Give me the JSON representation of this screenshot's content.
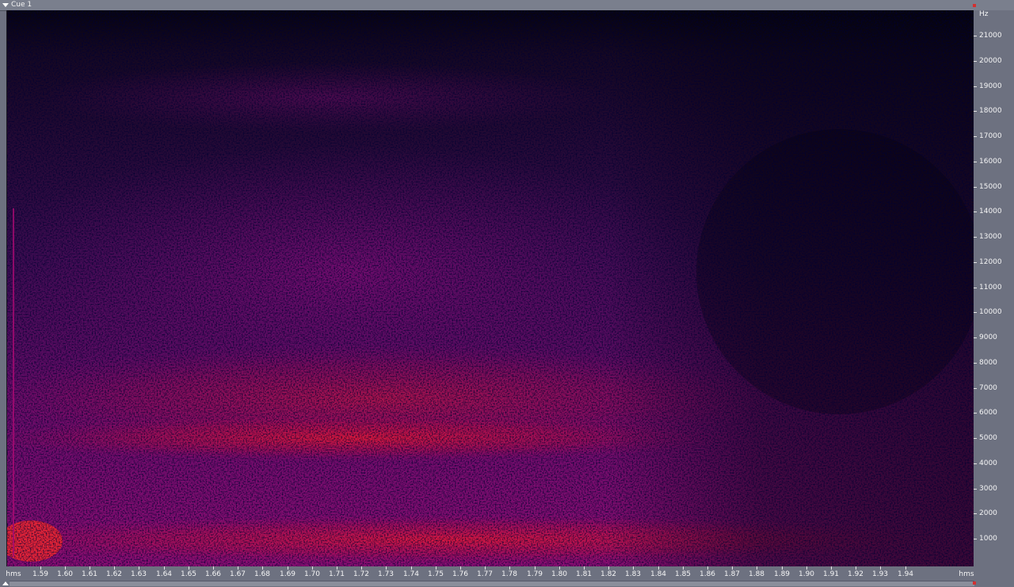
{
  "cue_title": "Cue 1",
  "y_axis": {
    "unit": "Hz",
    "ticks": [
      "21000",
      "20000",
      "19000",
      "18000",
      "17000",
      "16000",
      "15000",
      "14000",
      "13000",
      "12000",
      "11000",
      "10000",
      "9000",
      "8000",
      "7000",
      "6000",
      "5000",
      "4000",
      "3000",
      "2000",
      "1000"
    ]
  },
  "x_axis": {
    "unit_left": "hms",
    "unit_right": "hms",
    "ticks": [
      "1.59",
      "1.60",
      "1.61",
      "1.62",
      "1.63",
      "1.64",
      "1.65",
      "1.66",
      "1.67",
      "1.68",
      "1.69",
      "1.70",
      "1.71",
      "1.72",
      "1.73",
      "1.74",
      "1.75",
      "1.76",
      "1.77",
      "1.78",
      "1.79",
      "1.80",
      "1.81",
      "1.82",
      "1.83",
      "1.84",
      "1.85",
      "1.86",
      "1.87",
      "1.88",
      "1.89",
      "1.90",
      "1.91",
      "1.92",
      "1.93",
      "1.94"
    ]
  },
  "colors": {
    "background": "#06040f",
    "low": "#3a0a4e",
    "mid": "#8a0a7a",
    "high": "#ff1a2a",
    "peak": "#ff8a40"
  }
}
